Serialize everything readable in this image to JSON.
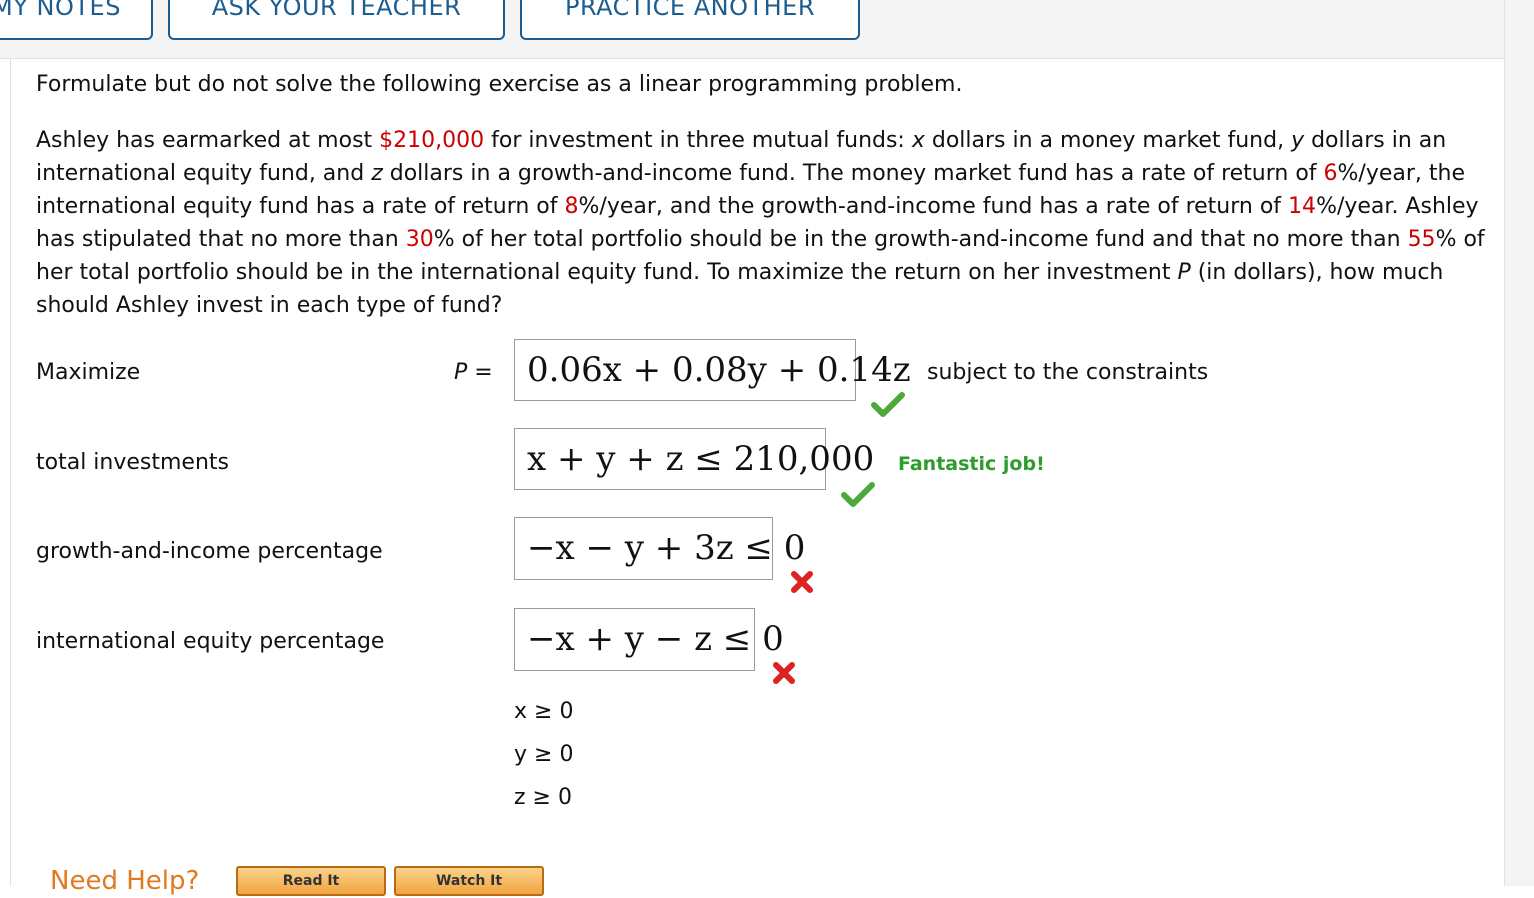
{
  "tabs": {
    "my_notes": "MY NOTES",
    "ask_teacher": "ASK YOUR TEACHER",
    "practice_another": "PRACTICE ANOTHER"
  },
  "instruction": "Formulate but do not solve the following exercise as a linear programming problem.",
  "problem": {
    "t1": "Ashley has earmarked at most ",
    "amount": "$210,000",
    "t2": " for investment in three mutual funds: ",
    "x": "x",
    "t3": " dollars in a money market fund, ",
    "y": "y",
    "t4": " dollars in an international equity fund, and ",
    "z": "z",
    "t5": " dollars in a growth-and-income fund. The money market fund has a rate of return of ",
    "rate1": "6",
    "t6": "%/year, the international equity fund has a rate of return of ",
    "rate2": "8",
    "t7": "%/year, and the growth-and-income fund has a rate of return of ",
    "rate3": "14",
    "t8": "%/year. Ashley has stipulated that no more than ",
    "pct1": "30",
    "t9": "% of her total portfolio should be in the growth-and-income fund and that no more than ",
    "pct2": "55",
    "t10": "% of her total portfolio should be in the international equity fund. To maximize the return on her investment ",
    "p": "P",
    "t11": " (in dollars), how much should Ashley invest in each type of fund?"
  },
  "objective": {
    "label": "Maximize",
    "p_var": "P",
    "equals": " =",
    "expression": "0.06x + 0.08y + 0.14z",
    "suffix": "subject to the constraints",
    "status": "correct"
  },
  "constraints": [
    {
      "label": "total investments",
      "expression": "x + y + z ≤ 210,000",
      "status": "correct"
    },
    {
      "label": "growth-and-income percentage",
      "expression": "−x − y + 3z ≤ 0",
      "status": "incorrect"
    },
    {
      "label": "international equity percentage",
      "expression": "−x + y − z ≤ 0",
      "status": "incorrect"
    }
  ],
  "feedback": "Fantastic job!",
  "nonnegativity": [
    "x ≥ 0",
    "y ≥ 0",
    "z ≥ 0"
  ],
  "help": {
    "title": "Need Help?",
    "read_it": "Read It",
    "watch_it": "Watch It"
  },
  "colors": {
    "accent_blue": "#1c5c8f",
    "highlight_red": "#cc0000",
    "correct_green": "#2a9d2a",
    "incorrect_red": "#dd2222",
    "help_orange": "#e07a1f"
  },
  "icons": {
    "correct": "check-icon",
    "incorrect": "cross-icon"
  }
}
